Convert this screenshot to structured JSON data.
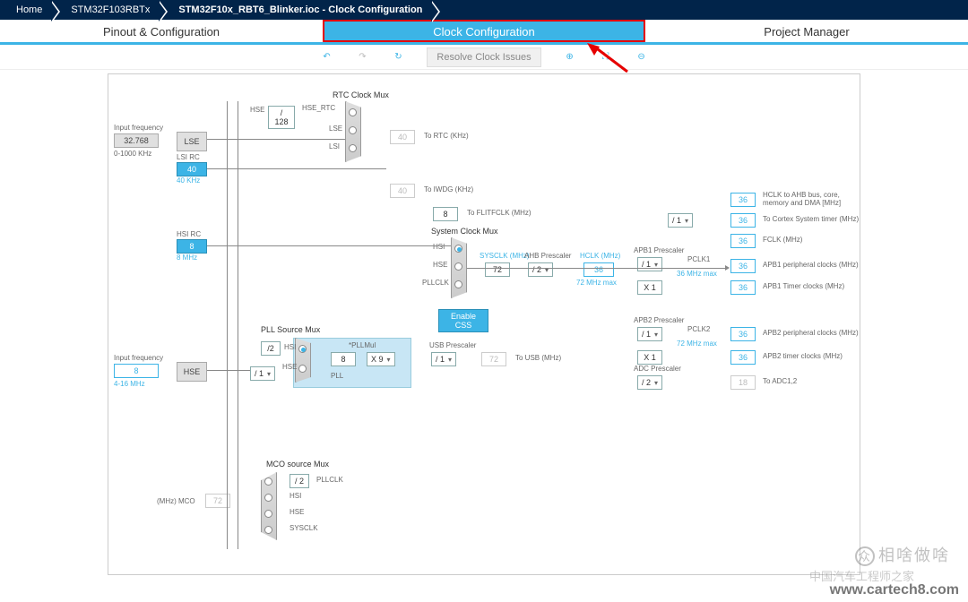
{
  "breadcrumb": [
    "Home",
    "STM32F103RBTx",
    "STM32F10x_RBT6_Blinker.ioc - Clock Configuration"
  ],
  "tabs": [
    "Pinout & Configuration",
    "Clock Configuration",
    "Project Manager"
  ],
  "toolbar": {
    "resolve": "Resolve Clock Issues"
  },
  "diagram": {
    "lse_freq_label": "Input frequency",
    "lse_freq": "32.768",
    "lse_range": "0-1000 KHz",
    "lse": "LSE",
    "lsi_rc": "LSI RC",
    "lsi_val": "40",
    "lsi_unit": "40 KHz",
    "hse_freq_label": "Input frequency",
    "hse_freq": "8",
    "hse_range": "4-16 MHz",
    "hse": "HSE",
    "hsi_rc": "HSI RC",
    "hsi_val": "8",
    "hsi_unit": "8 MHz",
    "rtc_mux": "RTC Clock Mux",
    "hse_rtc_div": "/ 128",
    "hse_rtc": "HSE_RTC",
    "lse_label": "LSE",
    "lsi_label": "LSI",
    "to_rtc_val": "40",
    "to_rtc": "To RTC (KHz)",
    "to_iwdg_val": "40",
    "to_iwdg": "To IWDG (KHz)",
    "to_flitfclk_val": "8",
    "to_flitfclk": "To FLITFCLK (MHz)",
    "pll_src_mux": "PLL Source Mux",
    "hse_div2": "/2",
    "hse_presc": "/ 1",
    "hsi_pll": "HSI",
    "hse_pll": "HSE",
    "pllmul": "*PLLMul",
    "pllmul_val": "8",
    "pllmul_sel": "X 9",
    "pll": "PLL",
    "sys_mux": "System Clock Mux",
    "sys_hsi": "HSI",
    "sys_hse": "HSE",
    "sys_pllclk": "PLLCLK",
    "enable_css": "Enable CSS",
    "sysclk_label": "SYSCLK (MHz)",
    "sysclk_val": "72",
    "ahb_presc_label": "AHB Prescaler",
    "ahb_presc": "/ 2",
    "hclk_label": "HCLK (MHz)",
    "hclk_val": "36",
    "hclk_max": "72 MHz max",
    "usb_presc_label": "USB Prescaler",
    "usb_presc": "/ 1",
    "to_usb_val": "72",
    "to_usb": "To USB (MHz)",
    "apb1_presc_label": "APB1 Prescaler",
    "apb1_presc": "/ 1",
    "apb1_mul": "X 1",
    "pclk1": "PCLK1",
    "pclk1_max": "36 MHz max",
    "apb2_presc_label": "APB2 Prescaler",
    "apb2_presc": "/ 1",
    "apb2_mul": "X 1",
    "pclk2": "PCLK2",
    "pclk2_max": "72 MHz max",
    "adc_presc_label": "ADC Prescaler",
    "adc_presc": "/ 2",
    "out_hclk_ahb_val": "36",
    "out_hclk_ahb": "HCLK to AHB bus, core, memory and DMA [MHz]",
    "out_cortex_div": "/ 1",
    "out_cortex_val": "36",
    "out_cortex": "To Cortex System timer (MHz)",
    "out_fclk_val": "36",
    "out_fclk": "FCLK (MHz)",
    "out_apb1p_val": "36",
    "out_apb1p": "APB1 peripheral clocks (MHz)",
    "out_apb1t_val": "36",
    "out_apb1t": "APB1 Timer clocks (MHz)",
    "out_apb2p_val": "36",
    "out_apb2p": "APB2 peripheral clocks (MHz)",
    "out_apb2t_val": "36",
    "out_apb2t": "APB2 timer clocks (MHz)",
    "out_adc_val": "18",
    "out_adc": "To ADC1,2",
    "mco_mux": "MCO source Mux",
    "mco_label": "(MHz) MCO",
    "mco_val": "72",
    "mco_div": "/ 2",
    "mco_pllclk": "PLLCLK",
    "mco_hsi": "HSI",
    "mco_hse": "HSE",
    "mco_sysclk": "SYSCLK"
  },
  "watermark_top": "相啥做啥",
  "watermark_mid": "中国汽车工程师之家",
  "watermark_url": "www.cartech8.com"
}
